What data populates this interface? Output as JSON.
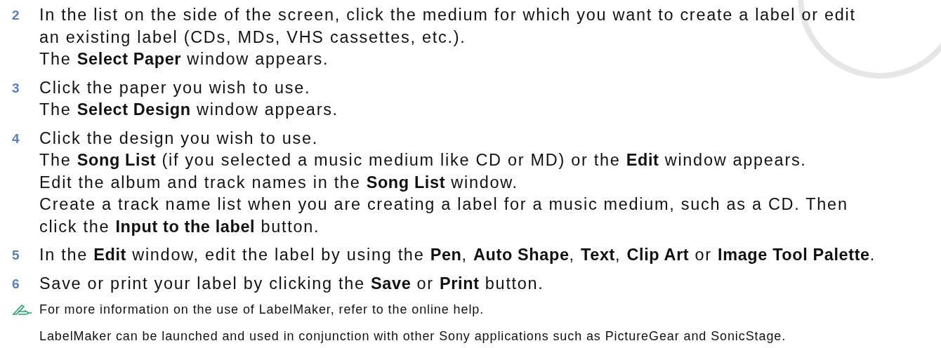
{
  "steps": [
    {
      "number": "2",
      "paragraphs": [
        "In the list on the side of the screen, click the medium for which you want to create a label or edit an existing label (CDs, MDs, VHS cassettes, etc.).",
        "The **Select Paper** window appears."
      ]
    },
    {
      "number": "3",
      "paragraphs": [
        "Click the paper you wish to use.",
        "The **Select Design** window appears."
      ]
    },
    {
      "number": "4",
      "paragraphs": [
        "Click the design you wish to use.",
        "The **Song List** (if you selected a music medium like CD or MD) or the **Edit** window appears.",
        "Edit the album and track names in the **Song List** window.",
        "Create a track name list when you are creating a label for a music medium, such as a CD. Then click the **Input to the label** button."
      ]
    },
    {
      "number": "5",
      "paragraphs": [
        "In the **Edit** window, edit the label by using the **Pen**, **Auto Shape**, **Text**, **Clip Art** or **Image Tool Palette**."
      ]
    },
    {
      "number": "6",
      "paragraphs": [
        "Save or print your label by clicking the **Save** or **Print** button."
      ]
    }
  ],
  "note": "For more information on the use of LabelMaker, refer to the online help.",
  "footer": "LabelMaker can be launched and used in conjunction with other Sony applications such as PictureGear and SonicStage."
}
